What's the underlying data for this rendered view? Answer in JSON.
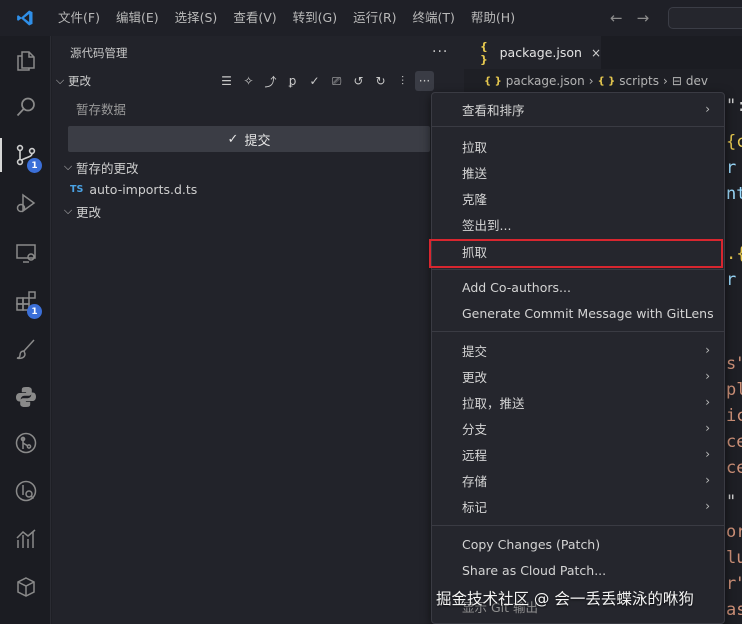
{
  "menubar": {
    "items": [
      "文件(F)",
      "编辑(E)",
      "选择(S)",
      "查看(V)",
      "转到(G)",
      "运行(R)",
      "终端(T)",
      "帮助(H)"
    ]
  },
  "nav": {
    "back": "←",
    "forward": "→"
  },
  "activity_bar": {
    "source_control_badge": "1",
    "extensions_badge": "1"
  },
  "sidebar": {
    "title": "源代码管理",
    "more": "···",
    "changes_section": "更改",
    "commit_placeholder": "暂存数据",
    "commit_button": "提交",
    "staged_group": "暂存的更改",
    "staged_file_type": "TS",
    "staged_file": "auto-imports.d.ts",
    "changes_group": "更改"
  },
  "editor": {
    "tab_label": "package.json",
    "tab_icon": "{ }",
    "tab_close": "×",
    "breadcrumb": [
      "package.json",
      "scripts",
      "dev"
    ],
    "breadcrumb_icon": "{ }"
  },
  "context_menu": {
    "items": [
      {
        "label": "查看和排序",
        "submenu": true
      },
      {
        "label": "拉取",
        "submenu": false
      },
      {
        "label": "推送",
        "submenu": false
      },
      {
        "label": "克隆",
        "submenu": false
      },
      {
        "label": "签出到...",
        "submenu": false
      },
      {
        "label": "抓取",
        "submenu": false
      },
      {
        "label": "Add Co-authors...",
        "submenu": false
      },
      {
        "label": "Generate Commit Message with GitLens",
        "submenu": false
      },
      {
        "label": "提交",
        "submenu": true
      },
      {
        "label": "更改",
        "submenu": true
      },
      {
        "label": "拉取，推送",
        "submenu": true
      },
      {
        "label": "分支",
        "submenu": true
      },
      {
        "label": "远程",
        "submenu": true
      },
      {
        "label": "存储",
        "submenu": true
      },
      {
        "label": "标记",
        "submenu": true
      },
      {
        "label": "Copy Changes (Patch)",
        "submenu": false
      },
      {
        "label": "Share as Cloud Patch...",
        "submenu": false
      },
      {
        "label": "显示 Git 输出",
        "submenu": false
      }
    ],
    "highlighted": "抓取"
  },
  "watermark": "掘金技术社区 @ 会一丢丢蝶泳的咻狗",
  "colors": {
    "accent": "#3b6fd8",
    "highlight_border": "#d8262f",
    "json_brace": "#e6c84f"
  }
}
